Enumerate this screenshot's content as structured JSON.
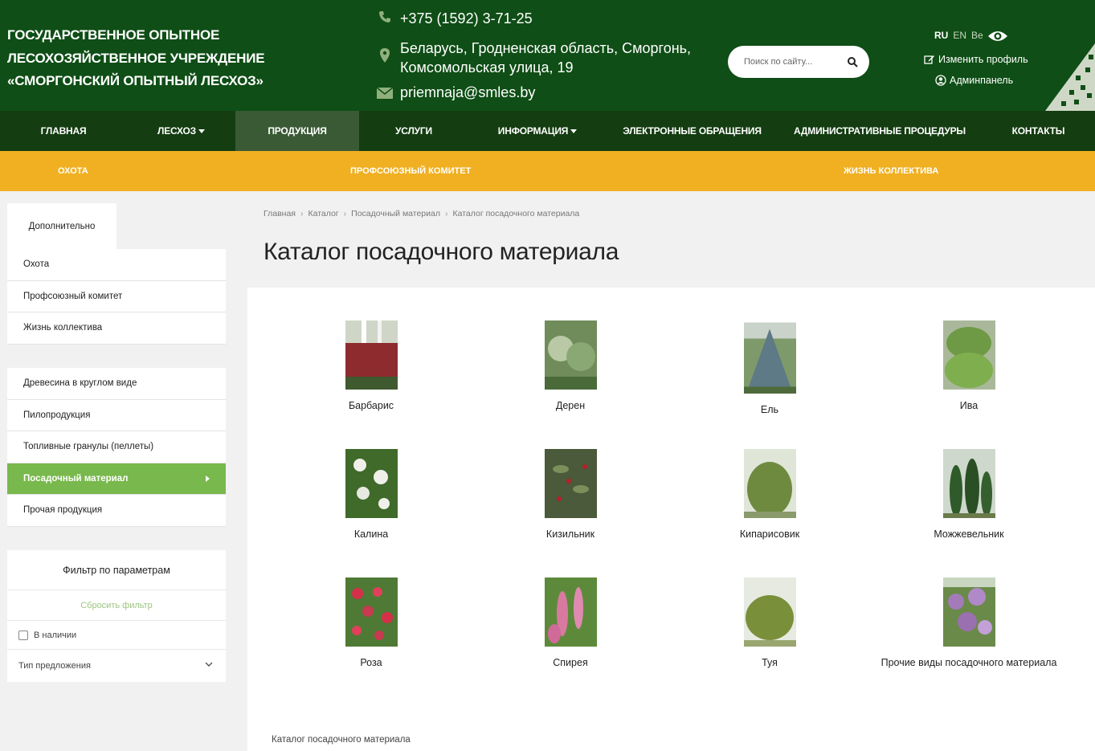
{
  "header": {
    "org_name": "Государственное опытное лесохозяйственное учреждение «Сморгонский опытный лесхоз»",
    "phone": "+375 (1592) 3-71-25",
    "address_line1": "Беларусь, Гродненская область, Сморгонь,",
    "address_line2": "Комсомольская улица, 19",
    "email": "priemnaja@smles.by",
    "search_placeholder": "Поиск по сайту...",
    "langs": [
      "RU",
      "EN",
      "Be"
    ],
    "profile_label": "Изменить профиль",
    "admin_label": "Админпанель"
  },
  "mainnav": [
    {
      "label": "Главная",
      "dropdown": false,
      "active": false
    },
    {
      "label": "Лесхоз",
      "dropdown": true,
      "active": false
    },
    {
      "label": "Продукция",
      "dropdown": false,
      "active": true
    },
    {
      "label": "Услуги",
      "dropdown": false,
      "active": false
    },
    {
      "label": "Информация",
      "dropdown": true,
      "active": false
    },
    {
      "label": "Электронные обращения",
      "dropdown": false,
      "active": false
    },
    {
      "label": "Административные процедуры",
      "dropdown": false,
      "active": false
    },
    {
      "label": "Контакты",
      "dropdown": false,
      "active": false
    }
  ],
  "subnav": [
    "Охота",
    "Профсоюзный комитет",
    "Жизнь коллектива"
  ],
  "sidebar": {
    "tab_label": "Дополнительно",
    "group1": [
      "Охота",
      "Профсоюзный комитет",
      "Жизнь коллектива"
    ],
    "group2": [
      "Древесина в круглом виде",
      "Пилопродукция",
      "Топливные гранулы (пеллеты)",
      "Посадочный материал",
      "Прочая продукция"
    ],
    "active_item": "Посадочный материал",
    "filter": {
      "title": "Фильтр по параметрам",
      "reset": "Сбросить фильтр",
      "in_stock": "В наличии",
      "offer_type": "Тип предложения"
    }
  },
  "breadcrumb": [
    "Главная",
    "Каталог",
    "Посадочный материал",
    "Каталог посадочного материала"
  ],
  "page_title": "Каталог посадочного материала",
  "products": [
    {
      "name": "Барбарис",
      "color": "#8e2b2f"
    },
    {
      "name": "Дерен",
      "color": "#6f8c5a"
    },
    {
      "name": "Ель",
      "color": "#5d7a86"
    },
    {
      "name": "Ива",
      "color": "#6e9a45"
    },
    {
      "name": "Калина",
      "color": "#3f6a2a"
    },
    {
      "name": "Кизильник",
      "color": "#4a5a3a"
    },
    {
      "name": "Кипарисовик",
      "color": "#6e8a3f"
    },
    {
      "name": "Можжевельник",
      "color": "#2f5a2a"
    },
    {
      "name": "Роза",
      "color": "#c73a50"
    },
    {
      "name": "Спирея",
      "color": "#d87aa0"
    },
    {
      "name": "Туя",
      "color": "#7a8f3a"
    },
    {
      "name": "Прочие виды посадочного материала",
      "color": "#a27bb8"
    }
  ],
  "seo_text": "Каталог посадочного материала"
}
